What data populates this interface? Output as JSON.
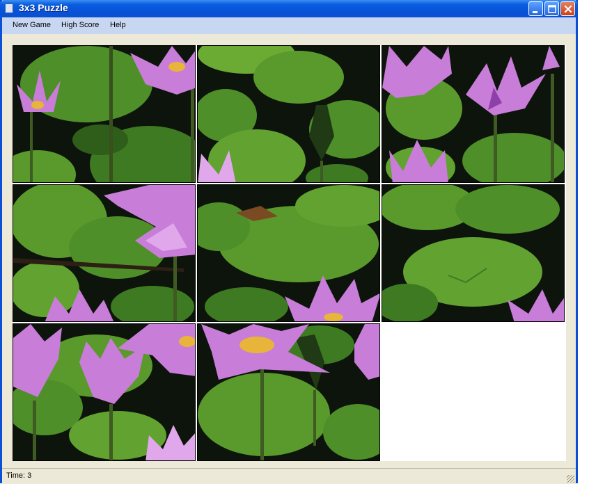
{
  "window": {
    "title": "3x3 Puzzle"
  },
  "menu": {
    "items": [
      "New Game",
      "High Score",
      "Help"
    ]
  },
  "board": {
    "rows": 3,
    "cols": 3,
    "empty_position": {
      "row": 3,
      "col": 3
    },
    "tiles": [
      {
        "row": 1,
        "col": 1
      },
      {
        "row": 1,
        "col": 2
      },
      {
        "row": 1,
        "col": 3
      },
      {
        "row": 2,
        "col": 1
      },
      {
        "row": 2,
        "col": 2
      },
      {
        "row": 2,
        "col": 3
      },
      {
        "row": 3,
        "col": 1
      },
      {
        "row": 3,
        "col": 2
      }
    ]
  },
  "status": {
    "time_label": "Time: 3"
  },
  "colors": {
    "title_bar": "#0a5ee0",
    "menu_bar": "#c7d7f2",
    "leaf_green": "#5a9a2c",
    "lotus_pink": "#c87dd8",
    "pond_dark": "#0d140b"
  }
}
